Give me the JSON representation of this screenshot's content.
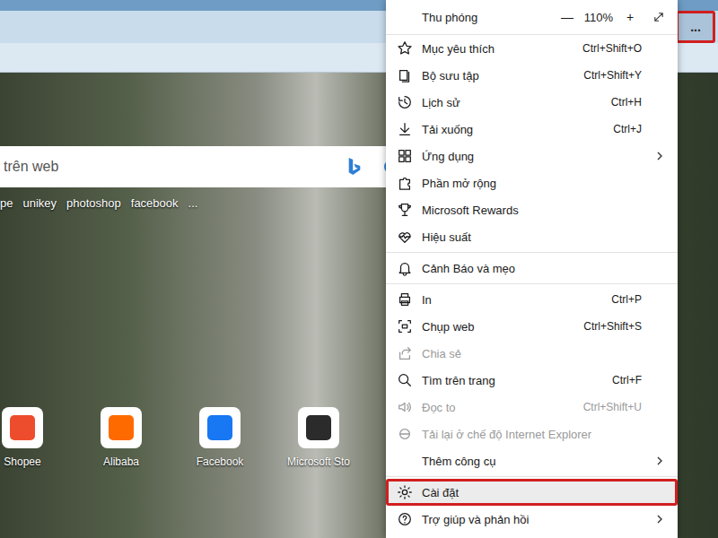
{
  "browser": {
    "more_button": {
      "label": "...",
      "highlighted": true
    }
  },
  "search": {
    "placeholder": "trên web"
  },
  "quick_links": [
    "pe",
    "unikey",
    "photoshop",
    "facebook",
    "..."
  ],
  "tiles": [
    {
      "label": "Shopee",
      "color": "#ee4d2d"
    },
    {
      "label": "Alibaba",
      "color": "#ff6a00"
    },
    {
      "label": "Facebook",
      "color": "#1877f2"
    },
    {
      "label": "Microsoft Sto",
      "color": "#2b2b2b"
    }
  ],
  "menu": {
    "zoom": {
      "label": "Thu phóng",
      "minus": "—",
      "value": "110%",
      "plus": "+"
    },
    "sections": [
      {
        "items": [
          {
            "label": "Mục yêu thích",
            "shortcut": "Ctrl+Shift+O",
            "disabled": false,
            "submenu": false,
            "highlighted": false
          },
          {
            "label": "Bộ sưu tập",
            "shortcut": "Ctrl+Shift+Y",
            "disabled": false,
            "submenu": false,
            "highlighted": false
          },
          {
            "label": "Lịch sử",
            "shortcut": "Ctrl+H",
            "disabled": false,
            "submenu": false,
            "highlighted": false
          },
          {
            "label": "Tải xuống",
            "shortcut": "Ctrl+J",
            "disabled": false,
            "submenu": false,
            "highlighted": false
          },
          {
            "label": "Ứng dụng",
            "shortcut": "",
            "disabled": false,
            "submenu": true,
            "highlighted": false
          },
          {
            "label": "Phần mở rộng",
            "shortcut": "",
            "disabled": false,
            "submenu": false,
            "highlighted": false
          },
          {
            "label": "Microsoft Rewards",
            "shortcut": "",
            "disabled": false,
            "submenu": false,
            "highlighted": false
          },
          {
            "label": "Hiệu suất",
            "shortcut": "",
            "disabled": false,
            "submenu": false,
            "highlighted": false
          }
        ]
      },
      {
        "items": [
          {
            "label": "Cảnh Báo và mẹo",
            "shortcut": "",
            "disabled": false,
            "submenu": false,
            "highlighted": false
          }
        ]
      },
      {
        "items": [
          {
            "label": "In",
            "shortcut": "Ctrl+P",
            "disabled": false,
            "submenu": false,
            "highlighted": false
          },
          {
            "label": "Chụp web",
            "shortcut": "Ctrl+Shift+S",
            "disabled": false,
            "submenu": false,
            "highlighted": false
          },
          {
            "label": "Chia sẻ",
            "shortcut": "",
            "disabled": true,
            "submenu": false,
            "highlighted": false
          },
          {
            "label": "Tìm trên trang",
            "shortcut": "Ctrl+F",
            "disabled": false,
            "submenu": false,
            "highlighted": false
          },
          {
            "label": "Đọc to",
            "shortcut": "Ctrl+Shift+U",
            "disabled": true,
            "submenu": false,
            "highlighted": false
          },
          {
            "label": "Tải lại ở chế độ Internet Explorer",
            "shortcut": "",
            "disabled": true,
            "submenu": false,
            "highlighted": false
          },
          {
            "label": "Thêm công cụ",
            "shortcut": "",
            "disabled": false,
            "submenu": true,
            "highlighted": false
          }
        ]
      },
      {
        "items": [
          {
            "label": "Cài đặt",
            "shortcut": "",
            "disabled": false,
            "submenu": false,
            "highlighted": true
          },
          {
            "label": "Trợ giúp và phản hồi",
            "shortcut": "",
            "disabled": false,
            "submenu": true,
            "highlighted": false
          }
        ]
      }
    ]
  }
}
